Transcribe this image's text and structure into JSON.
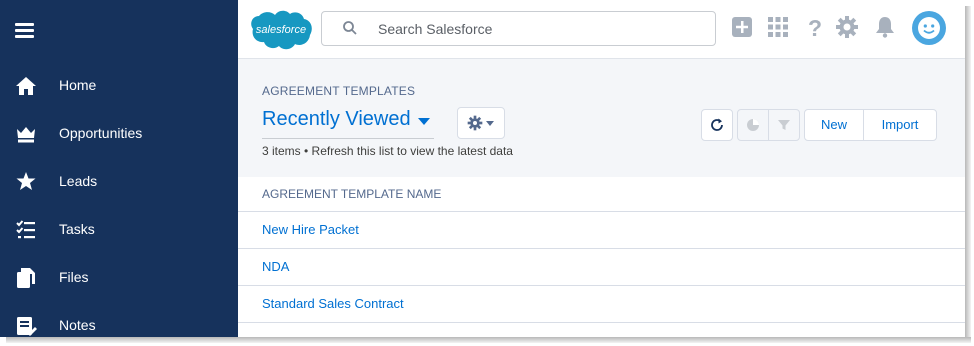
{
  "sidebar": {
    "items": [
      {
        "label": "Home",
        "icon": "home-icon"
      },
      {
        "label": "Opportunities",
        "icon": "crown-icon"
      },
      {
        "label": "Leads",
        "icon": "star-person-icon"
      },
      {
        "label": "Tasks",
        "icon": "checklist-icon"
      },
      {
        "label": "Files",
        "icon": "files-icon"
      },
      {
        "label": "Notes",
        "icon": "notes-icon"
      }
    ]
  },
  "header": {
    "logo_text": "salesforce",
    "search_placeholder": "Search Salesforce",
    "icons": [
      "add-icon",
      "app-launcher-icon",
      "help-icon",
      "setup-gear-icon",
      "notifications-bell-icon",
      "user-avatar"
    ]
  },
  "list": {
    "object_name": "AGREEMENT TEMPLATES",
    "view_name": "Recently Viewed",
    "meta": "3 items • Refresh this list to view the latest data",
    "buttons": {
      "new": "New",
      "import": "Import"
    }
  },
  "table": {
    "column_header": "AGREEMENT TEMPLATE NAME",
    "rows": [
      "New Hire Packet",
      "NDA",
      "Standard Sales Contract"
    ]
  },
  "colors": {
    "sidebar_bg": "#16325c",
    "link": "#0070d2",
    "brand": "#1798c1",
    "avatar": "#4aa6e0"
  }
}
